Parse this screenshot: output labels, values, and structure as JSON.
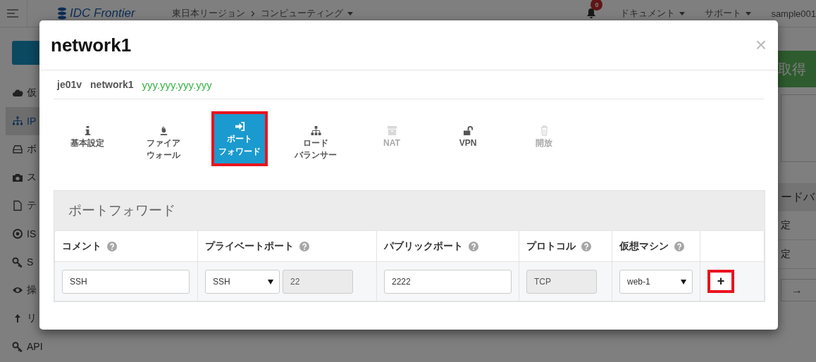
{
  "topbar": {
    "logo": "IDC Frontier",
    "breadcrumbs": [
      {
        "label": "東日本リージョン",
        "kind": "link"
      },
      {
        "label": "コンピューティング",
        "kind": "dropdown"
      }
    ],
    "notifications": "0",
    "menus": [
      "ドキュメント",
      "サポート",
      "sample001"
    ]
  },
  "sidebar": {
    "items": [
      {
        "label": "仮",
        "selected": false
      },
      {
        "label": "IP",
        "selected": true
      },
      {
        "label": "ボ",
        "selected": false
      },
      {
        "label": "ス",
        "selected": false
      },
      {
        "label": "テ",
        "selected": false
      },
      {
        "label": "IS",
        "selected": false
      },
      {
        "label": "S",
        "selected": false
      },
      {
        "label": "操",
        "selected": false
      },
      {
        "label": "リ",
        "selected": false
      },
      {
        "label": "API",
        "selected": false
      }
    ]
  },
  "right_panel": {
    "button": "取得",
    "heading": "ードバ",
    "rows": [
      "定",
      "定"
    ],
    "arrow": "→"
  },
  "modal": {
    "title": "network1",
    "close": "×",
    "info": {
      "zone": "je01v",
      "network": "network1",
      "ip": "yyy.yyy.yyy.yyy"
    },
    "tabs": [
      {
        "label": [
          "基本設定"
        ],
        "selected": false,
        "disabled": false,
        "highlighted": false
      },
      {
        "label": [
          "ファイア",
          "ウォール"
        ],
        "selected": false,
        "disabled": false,
        "highlighted": false
      },
      {
        "label": [
          "ポート",
          "フォワード"
        ],
        "selected": true,
        "disabled": false,
        "highlighted": true
      },
      {
        "label": [
          "ロード",
          "バランサー"
        ],
        "selected": false,
        "disabled": false,
        "highlighted": false
      },
      {
        "label": [
          "NAT"
        ],
        "selected": false,
        "disabled": true,
        "highlighted": false
      },
      {
        "label": [
          "VPN"
        ],
        "selected": false,
        "disabled": false,
        "highlighted": false
      },
      {
        "label": [
          "開放"
        ],
        "selected": false,
        "disabled": true,
        "highlighted": false
      }
    ],
    "section": {
      "title": "ポートフォワード",
      "columns": [
        "コメント",
        "プライベートポート",
        "パブリックポート",
        "プロトコル",
        "仮想マシン"
      ],
      "row": {
        "comment": "SSH",
        "private_service": "SSH",
        "private_port": "22",
        "public_port": "2222",
        "protocol": "TCP",
        "vm": "web-1",
        "add": "+",
        "add_highlighted": true
      }
    }
  }
}
